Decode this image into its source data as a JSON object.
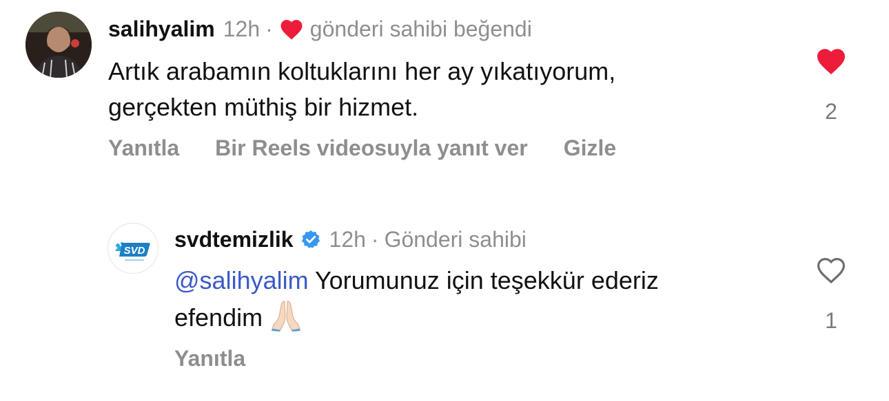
{
  "comment": {
    "username": "salihyalim",
    "time": "12h",
    "separator": "·",
    "liked_by_author": "gönderi sahibi beğendi",
    "text_line1": "Artık arabamın koltuklarını her ay yıkatıyorum,",
    "text_line2": "gerçekten müthiş bir hizmet.",
    "like_count": "2",
    "liked": true,
    "actions": {
      "reply": "Yanıtla",
      "reply_reels": "Bir Reels videosuyla yanıt ver",
      "hide": "Gizle"
    }
  },
  "reply": {
    "username": "svdtemizlik",
    "verified": true,
    "time": "12h",
    "separator": "·",
    "author_label": "Gönderi sahibi",
    "mention": "@salihyalim",
    "text_line1_rest": " Yorumunuz için teşekkür ederiz",
    "text_line2": "efendim",
    "emoji": "folded-hands",
    "like_count": "1",
    "liked": false,
    "actions": {
      "reply": "Yanıtla"
    },
    "logo_text": "SVD"
  },
  "colors": {
    "heart_red": "#ed1c3a",
    "verified_blue": "#3897f0",
    "mention_blue": "#3b59c4",
    "muted_gray": "#8e8e8e"
  }
}
